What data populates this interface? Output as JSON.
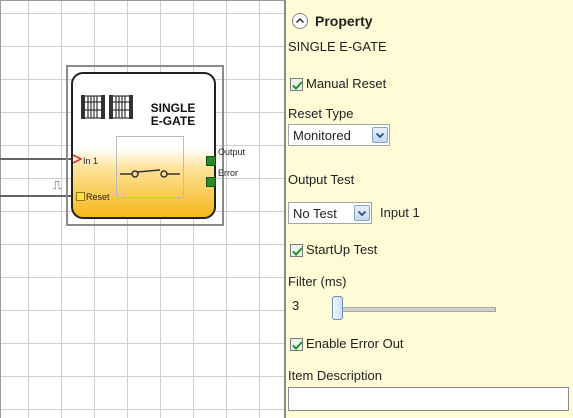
{
  "block": {
    "title_line1": "SINGLE",
    "title_line2": "E-GATE",
    "input1": "In 1",
    "reset": "Reset",
    "output": "Output",
    "error": "Error"
  },
  "property": {
    "heading": "Property",
    "subtitle": "SINGLE E-GATE",
    "manual_reset_label": "Manual Reset",
    "manual_reset_checked": true,
    "reset_type_label": "Reset Type",
    "reset_type_value": "Monitored",
    "output_test_label": "Output Test",
    "output_test_value": "No Test",
    "output_test_suffix": "Input 1",
    "startup_test_label": "StartUp Test",
    "startup_test_checked": true,
    "filter_label": "Filter (ms)",
    "filter_value": "3",
    "enable_error_label": "Enable Error Out",
    "enable_error_checked": true,
    "item_description_label": "Item Description",
    "item_description_value": ""
  },
  "colors": {
    "panel_bg": "#fffbd6",
    "block_gradient": "#f7b718",
    "port_green": "#2a8a2a",
    "input_arrow": "#e03030"
  }
}
